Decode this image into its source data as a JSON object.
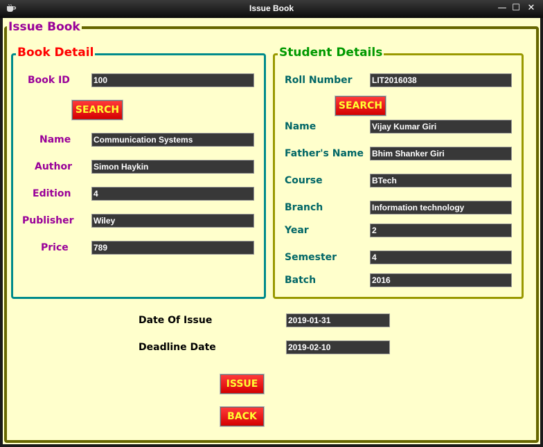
{
  "window": {
    "title": "Issue Book",
    "minimize_glyph": "—",
    "maximize_glyph": "☐",
    "close_glyph": "✕"
  },
  "main_group": {
    "title": "Issue Book"
  },
  "book_detail": {
    "title": "Book Detail",
    "book_id_label": "Book ID",
    "book_id_value": "100",
    "search_label": "SEARCH",
    "name_label": "Name",
    "name_value": "Communication Systems",
    "author_label": "Author",
    "author_value": "Simon Haykin",
    "edition_label": "Edition",
    "edition_value": "4",
    "publisher_label": "Publisher",
    "publisher_value": "Wiley",
    "price_label": "Price",
    "price_value": "789"
  },
  "student_details": {
    "title": "Student Details",
    "roll_label": "Roll Number",
    "roll_value": "LIT2016038",
    "search_label": "SEARCH",
    "name_label": "Name",
    "name_value": "Vijay Kumar Giri",
    "father_label": "Father's Name",
    "father_value": "Bhim Shanker Giri",
    "course_label": "Course",
    "course_value": "BTech",
    "branch_label": "Branch",
    "branch_value": "Information technology",
    "year_label": "Year",
    "year_value": "2",
    "semester_label": "Semester",
    "semester_value": "4",
    "batch_label": "Batch",
    "batch_value": "2016"
  },
  "dates": {
    "issue_label": "Date Of Issue",
    "issue_value": "2019-01-31",
    "deadline_label": "Deadline Date",
    "deadline_value": "2019-02-10"
  },
  "actions": {
    "issue_label": "ISSUE",
    "back_label": "BACK"
  },
  "colors": {
    "background": "#ffffcc",
    "main_border": "#666600",
    "book_border": "#008b8b",
    "student_border": "#999900",
    "book_title": "#ff0000",
    "student_title": "#009900",
    "main_title": "#990099",
    "book_labels": "#990099",
    "student_labels": "#006666",
    "button_face": "#ff0000",
    "button_text": "#ffff33"
  }
}
